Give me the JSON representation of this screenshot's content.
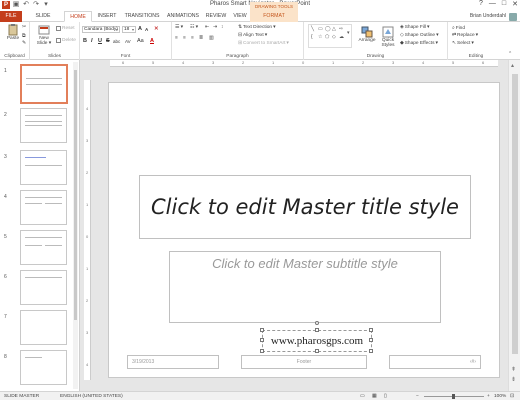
{
  "window": {
    "title": "Pharos Smart Navigator - PowerPoint",
    "controls": [
      "?",
      "—",
      "□",
      "✕"
    ]
  },
  "qat_icons": [
    "ppt-logo-icon",
    "save-icon",
    "undo-icon",
    "redo-icon",
    "customize-icon"
  ],
  "tabs": {
    "file": "FILE",
    "slide_master": "SLIDE MASTER",
    "home": "HOME",
    "insert": "INSERT",
    "transitions": "TRANSITIONS",
    "animations": "ANIMATIONS",
    "review": "REVIEW",
    "view": "VIEW",
    "contextual_group": "DRAWING TOOLS",
    "format": "FORMAT"
  },
  "user": {
    "name": "Brian Underdahl"
  },
  "ribbon": {
    "clipboard": {
      "label": "Clipboard",
      "paste": "Paste"
    },
    "slides": {
      "label": "Slides",
      "new_slide": "New Slide",
      "new_slide_arrow": "▾",
      "reset": "Reset",
      "delete": "Delete"
    },
    "font": {
      "label": "Font",
      "font_name": "Candara (Body)",
      "font_size": "18",
      "bold": "B",
      "italic": "I",
      "underline": "U",
      "strike": "S",
      "shadow": "abc",
      "spacing": "AV",
      "case": "Aa",
      "color": "A",
      "grow": "A",
      "shrink": "A"
    },
    "paragraph": {
      "label": "Paragraph",
      "text_direction": "Text Direction",
      "align_text": "Align Text",
      "smartart": "Convert to SmartArt"
    },
    "drawing": {
      "label": "Drawing",
      "arrange": "Arrange",
      "quick_styles": "Quick Styles",
      "shape_fill": "Shape Fill",
      "shape_outline": "Shape Outline",
      "shape_effects": "Shape Effects"
    },
    "editing": {
      "label": "Editing",
      "find": "Find",
      "replace": "Replace",
      "select": "Select"
    }
  },
  "thumbnails": [
    "1",
    "2",
    "3",
    "4",
    "5",
    "6",
    "7",
    "8"
  ],
  "ruler": {
    "h_ticks": [
      "6",
      "5",
      "4",
      "3",
      "2",
      "1",
      "0",
      "1",
      "2",
      "3",
      "4",
      "5",
      "6"
    ],
    "v_ticks": [
      "4",
      "3",
      "2",
      "1",
      "0",
      "1",
      "2",
      "3",
      "4"
    ]
  },
  "slide": {
    "title": "Click to edit Master title style",
    "subtitle": "Click to edit Master subtitle style",
    "url": "www.pharosgps.com",
    "date": "3/19/2013",
    "footer": "Footer",
    "slide_number": "‹#›"
  },
  "status": {
    "view": "SLIDE MASTER",
    "language": "ENGLISH (UNITED STATES)",
    "zoom": "100%"
  },
  "colors": {
    "accent": "#c43e1c",
    "contextual": "#fbe3c9"
  }
}
